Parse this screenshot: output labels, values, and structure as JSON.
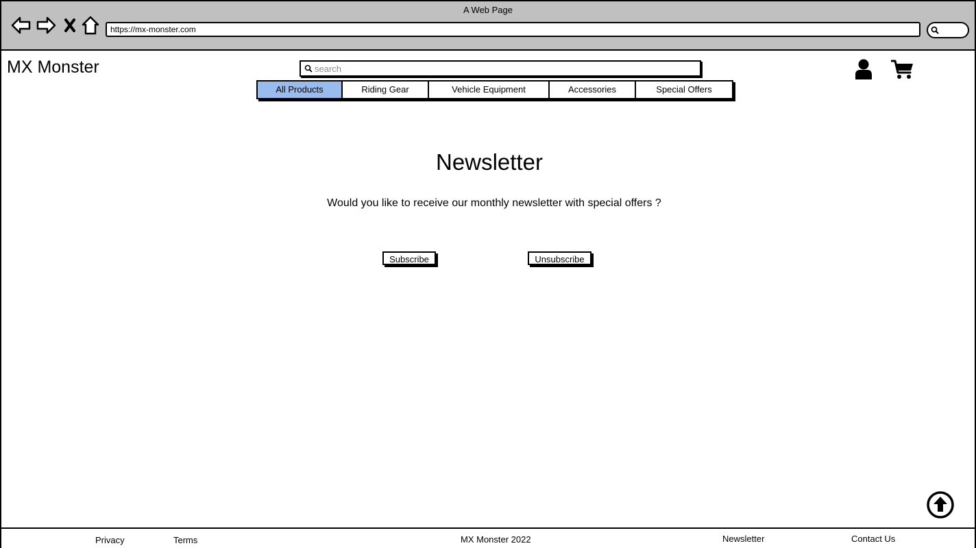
{
  "browser": {
    "window_title": "A Web Page",
    "url": "https://mx-monster.com",
    "nav_icons": [
      "back-arrow-icon",
      "forward-arrow-icon",
      "close-icon",
      "home-icon"
    ]
  },
  "header": {
    "logo": "MX Monster",
    "search_placeholder": "search",
    "icons": [
      "user-icon",
      "cart-icon"
    ]
  },
  "tabs": [
    {
      "label": "All Products",
      "active": true
    },
    {
      "label": "Riding Gear",
      "active": false
    },
    {
      "label": "Vehicle Equipment",
      "active": false
    },
    {
      "label": "Accessories",
      "active": false
    },
    {
      "label": "Special Offers",
      "active": false
    }
  ],
  "main": {
    "heading": "Newsletter",
    "question": "Would you like to receive our monthly newsletter with special offers ?",
    "subscribe_label": "Subscribe",
    "unsubscribe_label": "Unsubscribe"
  },
  "footer": {
    "privacy": "Privacy",
    "terms": "Terms",
    "copyright": "MX Monster 2022",
    "newsletter": "Newsletter",
    "contact": "Contact Us"
  },
  "colors": {
    "active_tab": "#99bbee",
    "chrome_background": "#c0c0c0"
  }
}
